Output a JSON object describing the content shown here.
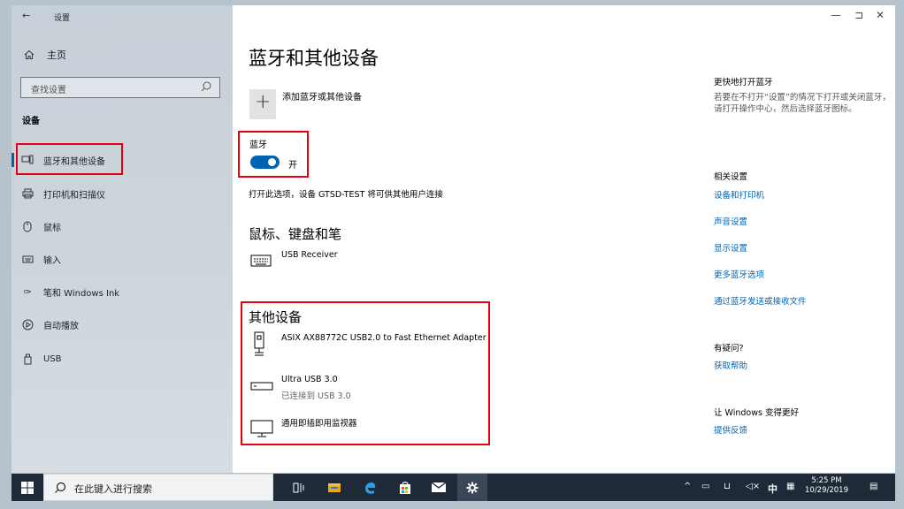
{
  "window": {
    "title": "设置",
    "controls": {
      "minimize": "—",
      "maximize": "⊐",
      "close": "✕"
    }
  },
  "sidebar": {
    "home_label": "主页",
    "search_placeholder": "查找设置",
    "section_heading": "设备",
    "items": [
      {
        "label": "蓝牙和其他设备",
        "icon": "bluetooth-devices-icon",
        "active": true
      },
      {
        "label": "打印机和扫描仪",
        "icon": "printer-icon",
        "active": false
      },
      {
        "label": "鼠标",
        "icon": "mouse-icon",
        "active": false
      },
      {
        "label": "输入",
        "icon": "keyboard-icon",
        "active": false
      },
      {
        "label": "笔和 Windows Ink",
        "icon": "pen-icon",
        "active": false
      },
      {
        "label": "自动播放",
        "icon": "autoplay-icon",
        "active": false
      },
      {
        "label": "USB",
        "icon": "usb-icon",
        "active": false
      }
    ]
  },
  "main": {
    "page_title": "蓝牙和其他设备",
    "add_device_label": "添加蓝牙或其他设备",
    "bluetooth": {
      "label": "蓝牙",
      "toggle_state": "开",
      "description": "打开此选项，设备 GTSD-TEST 将可供其他用户连接"
    },
    "mouse_section": {
      "heading": "鼠标、键盘和笔",
      "devices": [
        {
          "name": "USB Receiver"
        }
      ]
    },
    "other_section": {
      "heading": "其他设备",
      "devices": [
        {
          "name": "ASIX AX88772C USB2.0 to Fast Ethernet Adapter",
          "status": ""
        },
        {
          "name": "Ultra USB 3.0",
          "status": "已连接到 USB 3.0"
        },
        {
          "name": "通用即插即用监视器",
          "status": ""
        }
      ]
    }
  },
  "right_column": {
    "tip_heading": "更快地打开蓝牙",
    "tip_text": "若要在不打开“设置”的情况下打开或关闭蓝牙，请打开操作中心，然后选择蓝牙图标。",
    "related_heading": "相关设置",
    "related_links": [
      "设备和打印机",
      "声音设置",
      "显示设置",
      "更多蓝牙选项",
      "通过蓝牙发送或接收文件"
    ],
    "question_heading": "有疑问?",
    "help_link": "获取帮助",
    "feedback_heading": "让 Windows 变得更好",
    "feedback_link": "提供反馈"
  },
  "taskbar": {
    "search_placeholder": "在此键入进行搜索",
    "tray": {
      "ime": "中",
      "time": "5:25 PM",
      "date": "10/29/2019"
    }
  },
  "colors": {
    "accent": "#0063b1",
    "highlight_box": "#e60012",
    "taskbar": "#1e2a37"
  }
}
